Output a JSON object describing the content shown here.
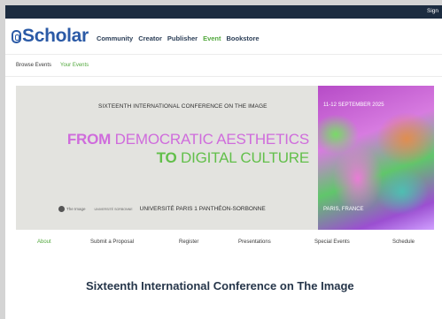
{
  "topbar": {
    "signin_label": "Sign"
  },
  "header": {
    "logo_text": "Scholar",
    "nav": [
      "Community",
      "Creator",
      "Publisher",
      "Event",
      "Bookstore"
    ],
    "active_nav": "Event"
  },
  "subnav": {
    "items": [
      "Browse Events",
      "Your Events"
    ],
    "active": "Your Events"
  },
  "banner": {
    "conference_title": "SIXTEENTH INTERNATIONAL CONFERENCE ON THE IMAGE",
    "line1_bold": "FROM",
    "line1_rest": " DEMOCRATIC AESTHETICS",
    "line2_bold": "TO",
    "line2_rest": " DIGITAL CULTURE",
    "logo1": "The Image",
    "logo2": "UNIVERSITÉ SORBONNE",
    "university": "UNIVERSITÉ PARIS 1 PANTHÉON-SORBONNE",
    "dates": "11-12 SEPTEMBER 2025",
    "location": "PARIS, FRANCE"
  },
  "tabs": [
    "About",
    "Submit a Proposal",
    "Register",
    "Presentations",
    "Special Events",
    "Schedule"
  ],
  "active_tab": "About",
  "main": {
    "title": "Sixteenth International Conference on The Image"
  },
  "colors": {
    "accent": "#52a83d",
    "brand": "#2b5aa6",
    "topbar": "#1c2c40",
    "headline_pink": "#cf6cdc",
    "headline_green": "#62bf4a"
  }
}
